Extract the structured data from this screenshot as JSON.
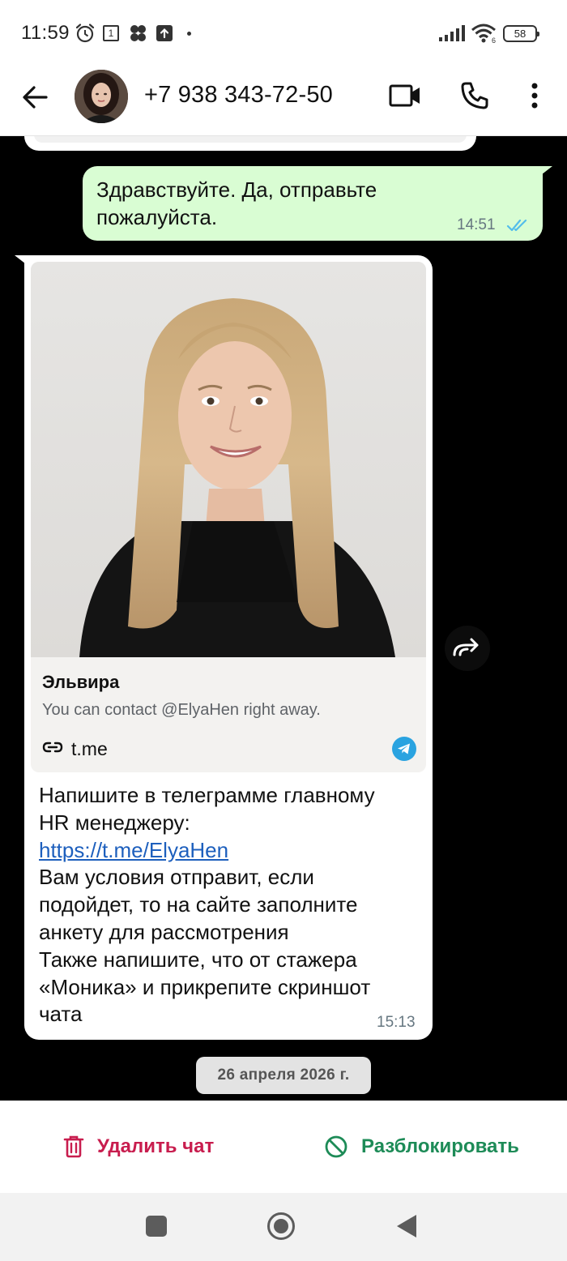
{
  "status_bar": {
    "time": "11:59",
    "calendar_day": "1",
    "battery": "58",
    "icons": [
      "alarm-icon",
      "calendar-icon",
      "app-notification-icon",
      "upload-icon",
      "signal-icon",
      "wifi-icon",
      "battery-icon"
    ]
  },
  "header": {
    "contact_name": "+7 938 343-72-50",
    "icons": [
      "back-arrow-icon",
      "video-call-icon",
      "phone-icon",
      "more-vert-icon"
    ]
  },
  "messages": {
    "outgoing": {
      "text": "Здравствуйте.  Да, отправьте пожалуйста.",
      "time": "14:51",
      "status": "read"
    },
    "incoming": {
      "preview": {
        "title": "Эльвира",
        "description": "You can contact @ElyaHen right away.",
        "domain": "t.me"
      },
      "lines": [
        "Напишите в телеграмме главному",
        "HR менеджеру:",
        "https://t.me/ElyaHen",
        "Вам условия отправит, если",
        "подойдет, то на сайте заполните",
        "анкету для рассмотрения",
        "Также напишите, что от стажера",
        "«Моника» и прикрепите скриншот",
        "чата"
      ],
      "time": "15:13"
    }
  },
  "date_chip": "26 апреля 2026 г.",
  "actions": {
    "delete_label": "Удалить чат",
    "unblock_label": "Разблокировать"
  },
  "colors": {
    "chat_background": "#000000",
    "outgoing_bubble": "#d9fdd3",
    "incoming_bubble": "#ffffff",
    "read_ticks": "#53bdeb",
    "link": "#1d5fbd",
    "delete": "#c81d4e",
    "unblock": "#1d8b57"
  }
}
